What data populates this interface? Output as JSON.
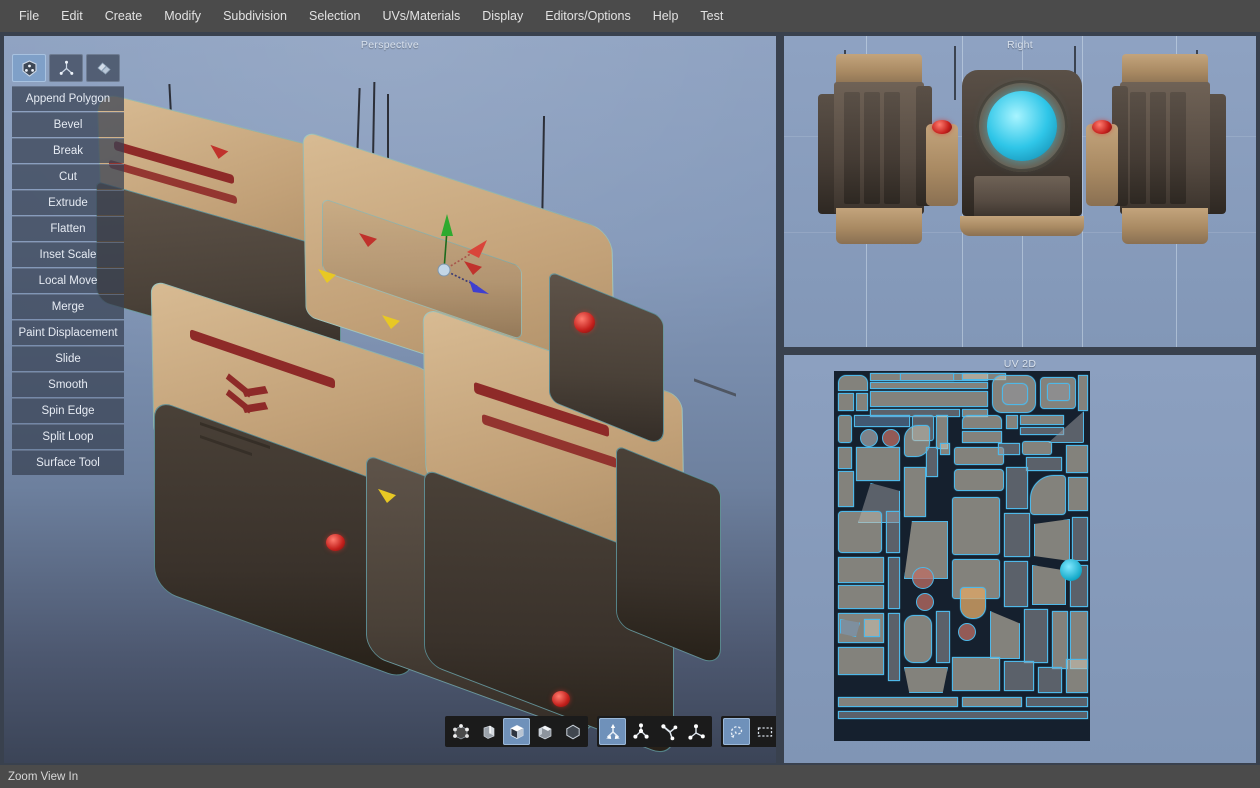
{
  "app": {
    "status_text": "Zoom View In",
    "accent_active": "#7fa0c8",
    "menubar_bg": "#4b4b4b",
    "viewport_bg": "#8ba0c0",
    "uv_bg": "#15202e",
    "uv_outline": "#4fb8e8"
  },
  "menubar": {
    "items": [
      {
        "label": "File"
      },
      {
        "label": "Edit"
      },
      {
        "label": "Create"
      },
      {
        "label": "Modify"
      },
      {
        "label": "Subdivision"
      },
      {
        "label": "Selection"
      },
      {
        "label": "UVs/Materials"
      },
      {
        "label": "Display"
      },
      {
        "label": "Editors/Options"
      },
      {
        "label": "Help"
      },
      {
        "label": "Test"
      }
    ]
  },
  "toolpanel": {
    "modes": [
      {
        "name": "vertex-mode",
        "active": true
      },
      {
        "name": "edge-mode",
        "active": false
      },
      {
        "name": "face-mode",
        "active": false
      }
    ],
    "tools": [
      {
        "label": "Append Polygon"
      },
      {
        "label": "Bevel"
      },
      {
        "label": "Break"
      },
      {
        "label": "Cut"
      },
      {
        "label": "Extrude"
      },
      {
        "label": "Flatten"
      },
      {
        "label": "Inset Scale"
      },
      {
        "label": "Local Move"
      },
      {
        "label": "Merge"
      },
      {
        "label": "Paint Displacement"
      },
      {
        "label": "Slide"
      },
      {
        "label": "Smooth"
      },
      {
        "label": "Spin Edge"
      },
      {
        "label": "Split Loop"
      },
      {
        "label": "Surface Tool"
      }
    ]
  },
  "viewports": [
    {
      "id": "perspective",
      "label": "Perspective"
    },
    {
      "id": "right",
      "label": "Right"
    },
    {
      "id": "uv2d",
      "label": "UV 2D"
    }
  ],
  "bottombar": {
    "select_modes": [
      {
        "name": "select-vertex-icon",
        "active": false
      },
      {
        "name": "select-edge-icon",
        "active": false
      },
      {
        "name": "select-face-icon",
        "active": true
      },
      {
        "name": "select-polygon-icon",
        "active": false
      },
      {
        "name": "select-object-icon",
        "active": false
      }
    ],
    "transform_tools": [
      {
        "name": "move-gizmo-icon",
        "active": true
      },
      {
        "name": "rotate-gizmo-icon",
        "active": false
      },
      {
        "name": "scale-gizmo-icon",
        "active": false
      },
      {
        "name": "universal-gizmo-icon",
        "active": false
      }
    ],
    "select_shapes": [
      {
        "name": "lasso-select-icon",
        "active": true
      },
      {
        "name": "rectangle-select-icon",
        "active": false
      },
      {
        "name": "paint-select-icon",
        "active": false
      }
    ]
  },
  "gizmo": {
    "axis_x_color": "#d9453a",
    "axis_y_color": "#2faa2f",
    "axis_z_color": "#3f3fd0"
  },
  "model": {
    "hull_tan": "#c2a178",
    "hull_dark": "#4a4138",
    "stripe_color": "#8e2a28",
    "marker_red": "#c0322c",
    "marker_yellow": "#e8c824",
    "light_red": "#c4201c",
    "engine_cyan": "#2fc6e8",
    "wireframe": "#78d2e1"
  }
}
